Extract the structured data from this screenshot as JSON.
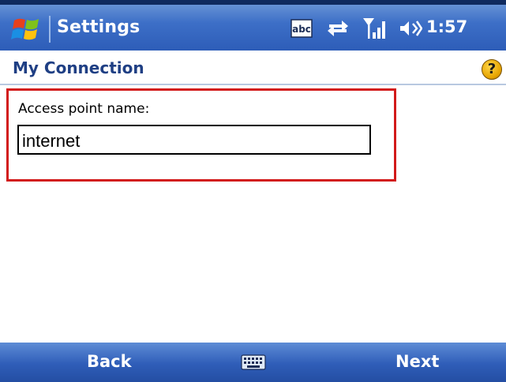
{
  "titlebar": {
    "app_title": "Settings",
    "abc_indicator": "abc",
    "time": "1:57",
    "icons": [
      "windows-start-icon",
      "abc-input-icon",
      "sync-arrows-icon",
      "signal-icon",
      "volume-icon"
    ]
  },
  "page": {
    "title": "My Connection",
    "help_icon": "?"
  },
  "form": {
    "label": "Access point name:",
    "value": "internet"
  },
  "softkeys": {
    "left": "Back",
    "right": "Next",
    "center_icon": "keyboard-icon"
  },
  "colors": {
    "titlebar": "#3d6fc7",
    "highlight_border": "#d21a1a",
    "page_title": "#1f3f84"
  }
}
